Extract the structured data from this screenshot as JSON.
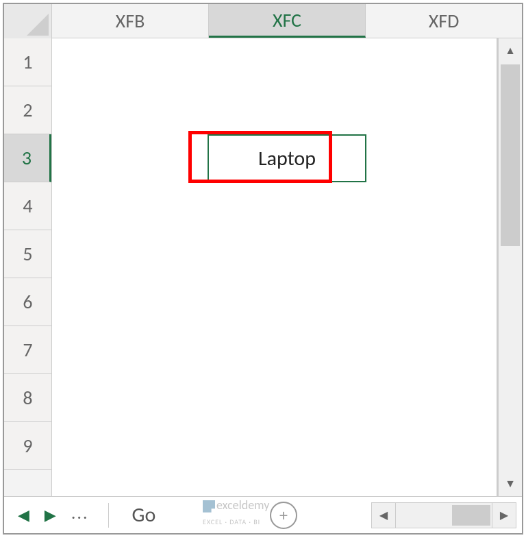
{
  "columns": {
    "c1": "XFB",
    "c2": "XFC",
    "c3": "XFD"
  },
  "rows": {
    "r1": "1",
    "r2": "2",
    "r3": "3",
    "r4": "4",
    "r5": "5",
    "r6": "6",
    "r7": "7",
    "r8": "8",
    "r9": "9"
  },
  "active_cell": {
    "value": "Laptop",
    "address": "XFC3"
  },
  "sheet_nav": {
    "tab_fragment": "Go "
  },
  "scroll": {
    "up": "▲",
    "down": "▼",
    "left": "◀",
    "right": "▶"
  },
  "nav_arrows": {
    "prev": "◀",
    "next": "▶",
    "more": "..."
  },
  "zoom_plus": "+",
  "watermark": {
    "brand": "exceldemy",
    "tagline": "EXCEL · DATA · BI"
  }
}
